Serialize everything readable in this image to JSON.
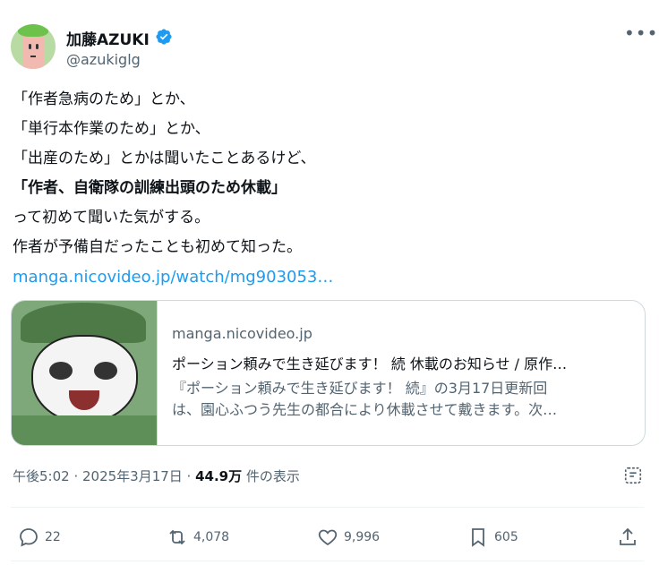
{
  "author": {
    "name": "加藤AZUKI",
    "handle": "@azukiglg",
    "verified": true,
    "avatar_icon": "avatar-image"
  },
  "tweet": {
    "lines": [
      "「作者急病のため」とか、",
      "「単行本作業のため」とか、",
      "「出産のため」とかは聞いたことあるけど、",
      "「作者、自衛隊の訓練出頭のため休載」",
      "って初めて聞いた気がする。",
      "作者が予備自だったことも初めて知った。"
    ],
    "link": "manga.nicovideo.jp/watch/mg903053…"
  },
  "card": {
    "domain": "manga.nicovideo.jp",
    "title": "ポーション頼みで生き延びます！ 続 休載のお知らせ / 原作…",
    "desc_line1": "『ポーション頼みで生き延びます！ 続』の3月17日更新回",
    "desc_line2": "は、園心ふつう先生の都合により休載させて戴きます。次…"
  },
  "meta": {
    "time": "午後5:02 · 2025年3月17日 · ",
    "views": "44.9万",
    "views_suffix": " 件の表示"
  },
  "actions": {
    "replies": "22",
    "reposts": "4,078",
    "likes": "9,996",
    "bookmarks": "605"
  },
  "colors": {
    "link": "#1d9bf0",
    "secondary_text": "#536471",
    "verified": "#1d9bf0"
  }
}
